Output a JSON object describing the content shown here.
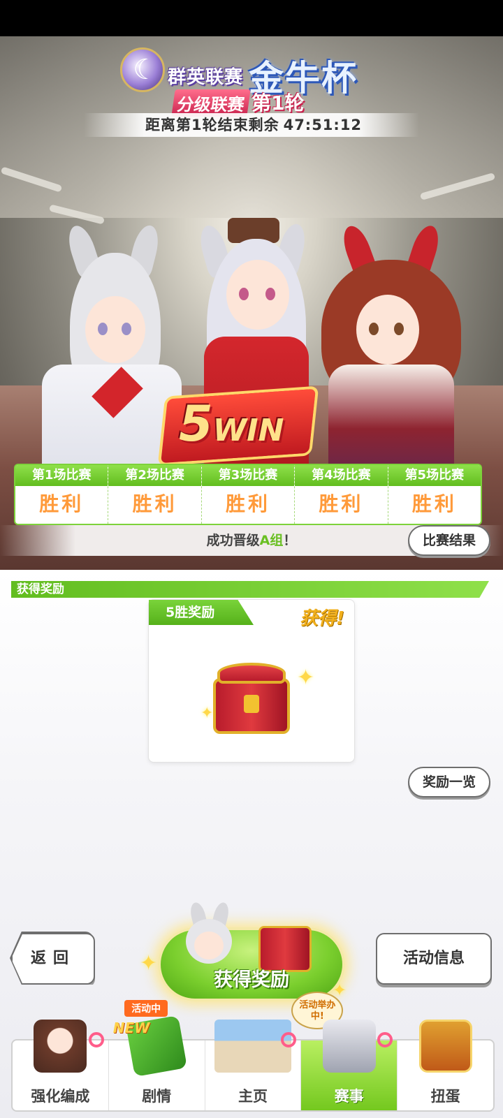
{
  "event": {
    "series_name": "群英联赛",
    "cup_name": "金牛杯",
    "league_tag": "分级联赛",
    "round_label": "第1轮",
    "countdown_label": "距离第1轮结束剩余",
    "countdown_value": "47:51:12",
    "win_badge_number": "5",
    "win_badge_word": "WIN"
  },
  "results": {
    "columns": [
      {
        "head": "第1场比赛",
        "value": "胜利"
      },
      {
        "head": "第2场比赛",
        "value": "胜利"
      },
      {
        "head": "第3场比赛",
        "value": "胜利"
      },
      {
        "head": "第4场比赛",
        "value": "胜利"
      },
      {
        "head": "第5场比赛",
        "value": "胜利"
      }
    ],
    "promo_prefix": "成功晋级",
    "promo_group": "A组",
    "promo_suffix": "！",
    "result_button": "比赛结果"
  },
  "rewards": {
    "section_title": "获得奖励",
    "card_label": "5胜奖励",
    "card_status": "获得!",
    "list_button": "奖励一览"
  },
  "actions": {
    "back": "返回",
    "claim": "获得奖励",
    "info": "活动信息"
  },
  "nav": {
    "items": [
      {
        "label": "强化编成",
        "icon": "enhance-icon"
      },
      {
        "label": "剧情",
        "icon": "story-icon",
        "badge": "活动中",
        "tag": "NEW"
      },
      {
        "label": "主页",
        "icon": "home-icon"
      },
      {
        "label": "赛事",
        "icon": "race-icon",
        "bubble": "活动举办中!",
        "active": true
      },
      {
        "label": "扭蛋",
        "icon": "gacha-icon"
      }
    ]
  },
  "colors": {
    "accent_green": "#62bd1f",
    "win_orange": "#ff9a3a",
    "banner_red": "#c01a20"
  }
}
